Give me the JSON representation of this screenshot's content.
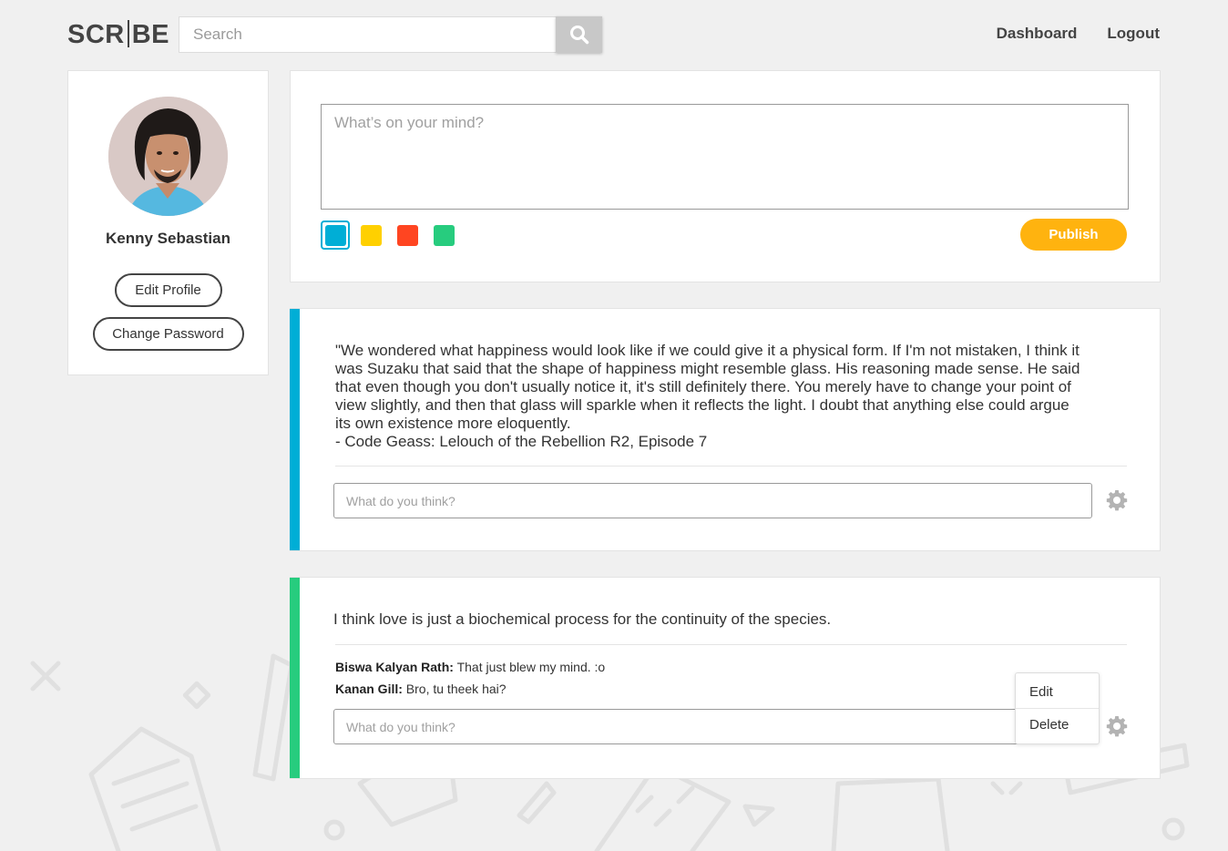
{
  "brand": {
    "logo_left": "SCR",
    "logo_right": "BE"
  },
  "search": {
    "placeholder": "Search"
  },
  "nav": {
    "dashboard": "Dashboard",
    "logout": "Logout"
  },
  "profile": {
    "name": "Kenny Sebastian",
    "edit_profile": "Edit Profile",
    "change_password": "Change Password"
  },
  "composer": {
    "placeholder": "What’s on your mind?",
    "colors": [
      "#00aed6",
      "#ffd000",
      "#ff4521",
      "#27cc7e"
    ],
    "selected_color": "#00aed6",
    "publish": "Publish"
  },
  "posts": [
    {
      "color": "#00aed6",
      "lines": [
        "\"We wondered what happiness would look like if we could give it a physical form. If I'm not mistaken, I think it",
        "was Suzaku that said that the shape of happiness might resemble glass. His reasoning made sense. He said",
        "that even though you don't usually notice it, it's still definitely there. You merely have to change your point of",
        "view slightly, and then that glass will sparkle when it reflects the light. I doubt that anything else could argue",
        "its own existence more eloquently.",
        "- Code Geass: Lelouch of the Rebellion R2, Episode 7"
      ],
      "comment_placeholder": "What do you think?"
    },
    {
      "color": "#27cc7e",
      "text": "I think love is just a biochemical process for the continuity of the species.",
      "comments": [
        {
          "author": "Biswa Kalyan Rath:",
          "text": "That just blew my mind. :o"
        },
        {
          "author": "Kanan Gill:",
          "text": "Bro, tu theek hai?"
        }
      ],
      "comment_placeholder": "What do you think?",
      "menu": {
        "edit": "Edit",
        "delete": "Delete"
      }
    }
  ]
}
